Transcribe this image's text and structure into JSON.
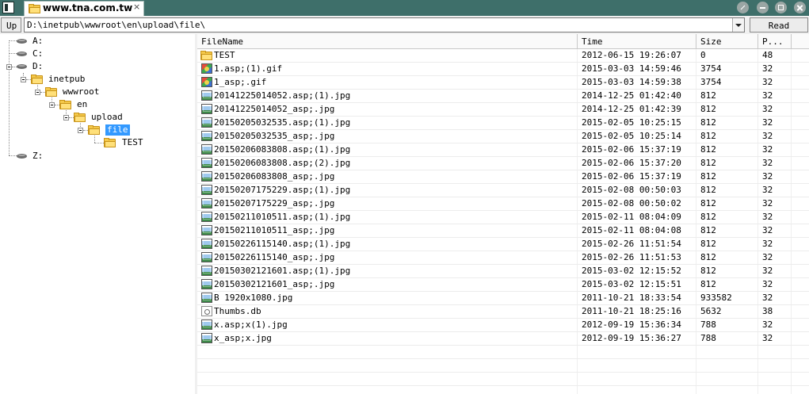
{
  "tab": {
    "title": "www.tna.com.tw",
    "close": "×"
  },
  "toolbar": {
    "up_label": "Up",
    "path": "D:\\inetpub\\wwwroot\\en\\upload\\file\\",
    "read_label": "Read"
  },
  "tree": {
    "drive_a": "A:",
    "drive_c": "C:",
    "drive_d": "D:",
    "inetpub": "inetpub",
    "wwwroot": "wwwroot",
    "en": "en",
    "upload": "upload",
    "file": "file",
    "test": "TEST",
    "drive_z": "Z:"
  },
  "list": {
    "columns": [
      "FileName",
      "Time",
      "Size",
      "P..."
    ],
    "rows": [
      {
        "icon": "folder-icon",
        "name": "TEST",
        "time": "2012-06-15 19:26:07",
        "size": "0",
        "p": "48"
      },
      {
        "icon": "gif-image-icon",
        "name": "1.asp;(1).gif",
        "time": "2015-03-03 14:59:46",
        "size": "3754",
        "p": "32"
      },
      {
        "icon": "gif-image-icon",
        "name": "1_asp;.gif",
        "time": "2015-03-03 14:59:38",
        "size": "3754",
        "p": "32"
      },
      {
        "icon": "image-file-icon",
        "name": "20141225014052.asp;(1).jpg",
        "time": "2014-12-25 01:42:40",
        "size": "812",
        "p": "32"
      },
      {
        "icon": "image-file-icon",
        "name": "20141225014052_asp;.jpg",
        "time": "2014-12-25 01:42:39",
        "size": "812",
        "p": "32"
      },
      {
        "icon": "image-file-icon",
        "name": "20150205032535.asp;(1).jpg",
        "time": "2015-02-05 10:25:15",
        "size": "812",
        "p": "32"
      },
      {
        "icon": "image-file-icon",
        "name": "20150205032535_asp;.jpg",
        "time": "2015-02-05 10:25:14",
        "size": "812",
        "p": "32"
      },
      {
        "icon": "image-file-icon",
        "name": "20150206083808.asp;(1).jpg",
        "time": "2015-02-06 15:37:19",
        "size": "812",
        "p": "32"
      },
      {
        "icon": "image-file-icon",
        "name": "20150206083808.asp;(2).jpg",
        "time": "2015-02-06 15:37:20",
        "size": "812",
        "p": "32"
      },
      {
        "icon": "image-file-icon",
        "name": "20150206083808_asp;.jpg",
        "time": "2015-02-06 15:37:19",
        "size": "812",
        "p": "32"
      },
      {
        "icon": "image-file-icon",
        "name": "20150207175229.asp;(1).jpg",
        "time": "2015-02-08 00:50:03",
        "size": "812",
        "p": "32"
      },
      {
        "icon": "image-file-icon",
        "name": "20150207175229_asp;.jpg",
        "time": "2015-02-08 00:50:02",
        "size": "812",
        "p": "32"
      },
      {
        "icon": "image-file-icon",
        "name": "20150211010511.asp;(1).jpg",
        "time": "2015-02-11 08:04:09",
        "size": "812",
        "p": "32"
      },
      {
        "icon": "image-file-icon",
        "name": "20150211010511_asp;.jpg",
        "time": "2015-02-11 08:04:08",
        "size": "812",
        "p": "32"
      },
      {
        "icon": "image-file-icon",
        "name": "20150226115140.asp;(1).jpg",
        "time": "2015-02-26 11:51:54",
        "size": "812",
        "p": "32"
      },
      {
        "icon": "image-file-icon",
        "name": "20150226115140_asp;.jpg",
        "time": "2015-02-26 11:51:53",
        "size": "812",
        "p": "32"
      },
      {
        "icon": "image-file-icon",
        "name": "20150302121601.asp;(1).jpg",
        "time": "2015-03-02 12:15:52",
        "size": "812",
        "p": "32"
      },
      {
        "icon": "image-file-icon",
        "name": "20150302121601_asp;.jpg",
        "time": "2015-03-02 12:15:51",
        "size": "812",
        "p": "32"
      },
      {
        "icon": "image-file-icon",
        "name": "B 1920x1080.jpg",
        "time": "2011-10-21 18:33:54",
        "size": "933582",
        "p": "32"
      },
      {
        "icon": "db-file-icon",
        "name": "Thumbs.db",
        "time": "2011-10-21 18:25:16",
        "size": "5632",
        "p": "38"
      },
      {
        "icon": "image-file-icon",
        "name": "x.asp;x(1).jpg",
        "time": "2012-09-19 15:36:34",
        "size": "788",
        "p": "32"
      },
      {
        "icon": "image-file-icon",
        "name": "x_asp;x.jpg",
        "time": "2012-09-19 15:36:27",
        "size": "788",
        "p": "32"
      }
    ]
  },
  "colors": {
    "titlebar": "#3e6f6a",
    "selection": "#3399ff",
    "folder": "#f4c84a"
  }
}
